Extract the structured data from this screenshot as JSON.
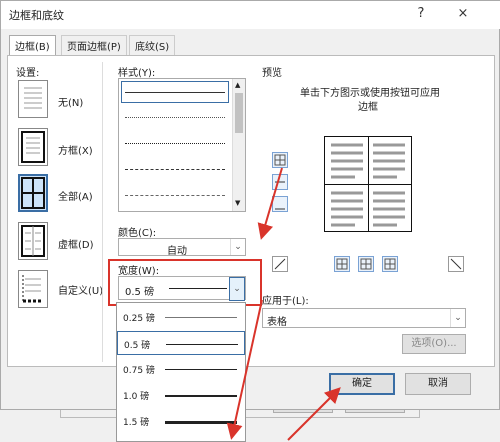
{
  "window": {
    "title": "边框和底纹",
    "help": "?",
    "close": "×"
  },
  "tabs": [
    "边框(B)",
    "页面边框(P)",
    "底纹(S)"
  ],
  "settings": {
    "label": "设置:",
    "items": [
      "无(N)",
      "方框(X)",
      "全部(A)",
      "虚框(D)",
      "自定义(U)"
    ]
  },
  "style": {
    "label": "样式(Y):"
  },
  "color": {
    "label": "颜色(C):",
    "value": "自动"
  },
  "width": {
    "label": "宽度(W):",
    "value": "0.5 磅",
    "options": [
      "0.25 磅",
      "0.5 磅",
      "0.75 磅",
      "1.0 磅",
      "1.5 磅"
    ]
  },
  "preview": {
    "label": "预览",
    "hint_line1": "单击下方图示或使用按钮可应用",
    "hint_line2": "边框"
  },
  "apply_to": {
    "label": "应用于(L):",
    "value": "表格"
  },
  "options_button": "选项(O)...",
  "ok_button": "确定",
  "cancel_button": "取消",
  "background_dialog": {
    "ok": "确定",
    "cancel": "取消"
  },
  "colors": {
    "accent": "#3a6ea5",
    "highlight": "#d9342b"
  }
}
